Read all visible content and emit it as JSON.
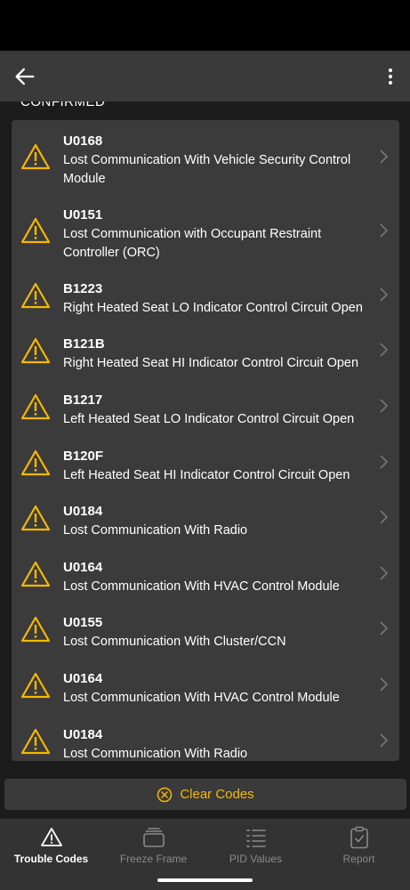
{
  "section": {
    "header": "CONFIRMED"
  },
  "codes": [
    {
      "code": "U0168",
      "description": "Lost Communication With Vehicle Security Control Module"
    },
    {
      "code": "U0151",
      "description": "Lost Communication with Occupant Restraint Controller (ORC)"
    },
    {
      "code": "B1223",
      "description": "Right Heated Seat LO Indicator Control Circuit Open"
    },
    {
      "code": "B121B",
      "description": "Right Heated Seat HI Indicator Control Circuit Open"
    },
    {
      "code": "B1217",
      "description": "Left Heated Seat LO Indicator Control Circuit Open"
    },
    {
      "code": "B120F",
      "description": "Left Heated Seat HI Indicator Control Circuit Open"
    },
    {
      "code": "U0184",
      "description": "Lost Communication With Radio"
    },
    {
      "code": "U0164",
      "description": "Lost Communication With HVAC Control Module"
    },
    {
      "code": "U0155",
      "description": "Lost Communication With Cluster/CCN"
    },
    {
      "code": "U0164",
      "description": "Lost Communication With HVAC Control Module"
    },
    {
      "code": "U0184",
      "description": "Lost Communication With Radio"
    }
  ],
  "actions": {
    "clear_codes": "Clear Codes"
  },
  "nav": {
    "trouble_codes": "Trouble Codes",
    "freeze_frame": "Freeze Frame",
    "pid_values": "PID Values",
    "report": "Report"
  },
  "colors": {
    "accent": "#f5b800",
    "card": "#3b3b3b",
    "background": "#1c1c1c"
  },
  "icons": [
    "back-arrow-icon",
    "more-vert-icon",
    "warning-icon",
    "chevron-right-icon",
    "clear-icon",
    "trouble-codes-icon",
    "freeze-frame-icon",
    "pid-values-icon",
    "report-icon"
  ]
}
